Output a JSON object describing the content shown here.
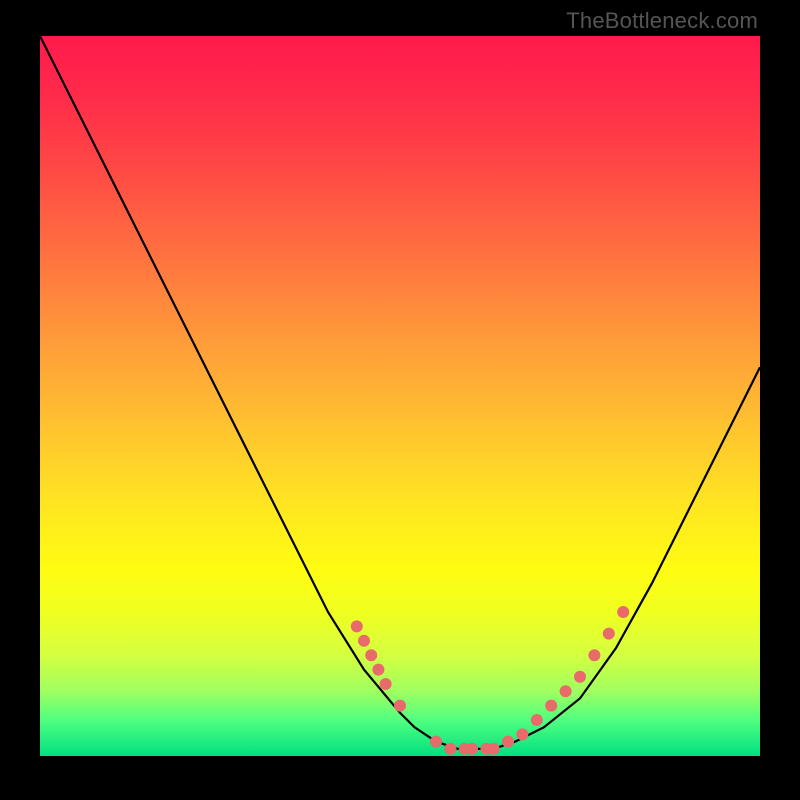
{
  "watermark": "TheBottleneck.com",
  "chart_data": {
    "type": "line",
    "title": "",
    "xlabel": "",
    "ylabel": "",
    "xlim": [
      0,
      100
    ],
    "ylim": [
      0,
      100
    ],
    "series": [
      {
        "name": "curve",
        "x": [
          0,
          5,
          10,
          15,
          20,
          25,
          30,
          35,
          40,
          45,
          50,
          52,
          55,
          58,
          60,
          63,
          66,
          70,
          75,
          80,
          85,
          90,
          95,
          100
        ],
        "y": [
          100,
          90,
          80,
          70,
          60,
          50,
          40,
          30,
          20,
          12,
          6,
          4,
          2,
          1,
          1,
          1,
          2,
          4,
          8,
          15,
          24,
          34,
          44,
          54
        ]
      },
      {
        "name": "markers-left-descent",
        "x": [
          44,
          45,
          46,
          47,
          48,
          50
        ],
        "y": [
          18,
          16,
          14,
          12,
          10,
          7
        ]
      },
      {
        "name": "markers-valley",
        "x": [
          55,
          57,
          59,
          60,
          62,
          63,
          65,
          67
        ],
        "y": [
          2,
          1,
          1,
          1,
          1,
          1,
          2,
          3
        ]
      },
      {
        "name": "markers-right-ascent",
        "x": [
          69,
          71,
          73,
          75,
          77,
          79,
          81
        ],
        "y": [
          5,
          7,
          9,
          11,
          14,
          17,
          20
        ]
      }
    ],
    "marker_color": "#e86a6a",
    "curve_color": "#000000"
  }
}
